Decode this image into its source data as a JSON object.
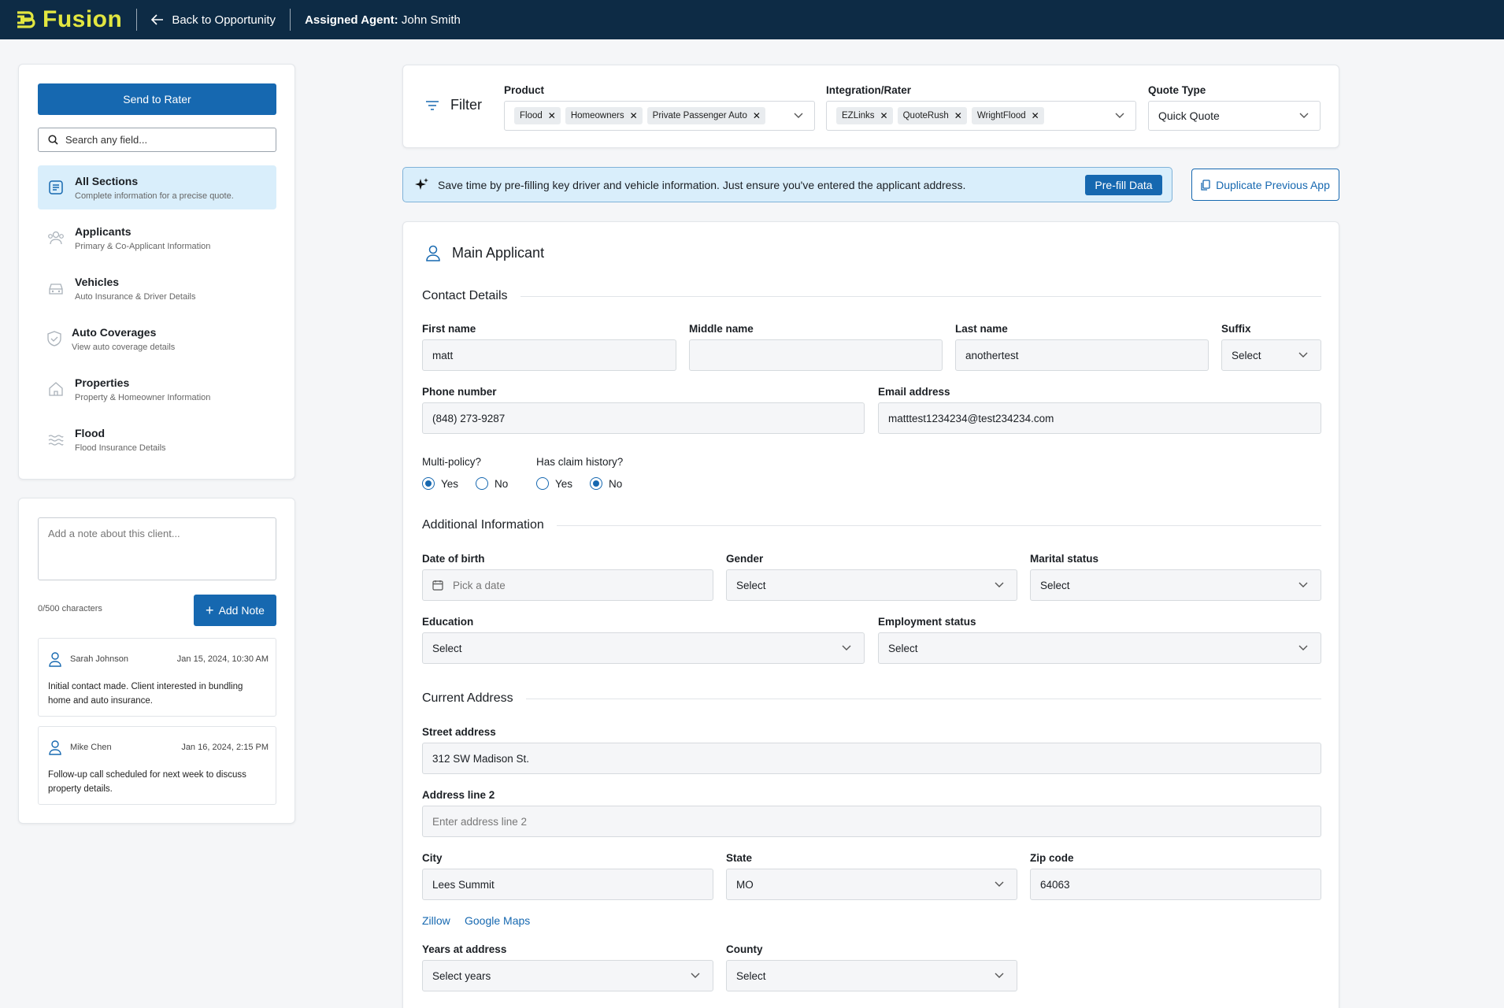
{
  "topbar": {
    "logo_text": "Fusion",
    "back_label": "Back to Opportunity",
    "agent_label": "Assigned Agent:",
    "agent_name": "John Smith"
  },
  "sidebar": {
    "send_label": "Send to Rater",
    "search_placeholder": "Search any field...",
    "items": [
      {
        "title": "All Sections",
        "subtitle": "Complete information for a precise quote.",
        "icon": "all-sections-icon",
        "active": true
      },
      {
        "title": "Applicants",
        "subtitle": "Primary & Co-Applicant Information",
        "icon": "applicants-icon"
      },
      {
        "title": "Vehicles",
        "subtitle": "Auto Insurance & Driver Details",
        "icon": "car-icon"
      },
      {
        "title": "Auto Coverages",
        "subtitle": "View auto coverage details",
        "icon": "shield-icon"
      },
      {
        "title": "Properties",
        "subtitle": "Property & Homeowner Information",
        "icon": "house-icon"
      },
      {
        "title": "Flood",
        "subtitle": "Flood Insurance Details",
        "icon": "waves-icon"
      }
    ]
  },
  "notes": {
    "placeholder": "Add a note about this client...",
    "char_count": "0/500 characters",
    "add_label": "Add Note",
    "entries": [
      {
        "author": "Sarah Johnson",
        "date": "Jan 15, 2024, 10:30 AM",
        "text": "Initial contact made. Client interested in bundling home and auto insurance."
      },
      {
        "author": "Mike Chen",
        "date": "Jan 16, 2024, 2:15 PM",
        "text": "Follow-up call scheduled for next week to discuss property details."
      }
    ]
  },
  "filter": {
    "label": "Filter",
    "product": {
      "label": "Product",
      "chips": [
        "Flood",
        "Homeowners",
        "Private Passenger Auto"
      ]
    },
    "integration": {
      "label": "Integration/Rater",
      "chips": [
        "EZLinks",
        "QuoteRush",
        "WrightFlood"
      ]
    },
    "quote_type": {
      "label": "Quote Type",
      "value": "Quick Quote"
    }
  },
  "prefill": {
    "message": "Save time by pre-filling key driver and vehicle information. Just ensure you've entered the applicant address.",
    "button": "Pre-fill Data"
  },
  "duplicate_label": "Duplicate Previous App",
  "main": {
    "title": "Main Applicant",
    "contact": {
      "heading": "Contact Details",
      "first_name": {
        "label": "First name",
        "value": "matt"
      },
      "middle_name": {
        "label": "Middle name",
        "value": ""
      },
      "last_name": {
        "label": "Last name",
        "value": "anothertest"
      },
      "suffix": {
        "label": "Suffix",
        "value": "Select"
      },
      "phone": {
        "label": "Phone number",
        "value": "(848) 273-9287"
      },
      "email": {
        "label": "Email address",
        "value": "matttest1234234@test234234.com"
      },
      "multi_policy": {
        "label": "Multi-policy?",
        "yes": "Yes",
        "no": "No",
        "selected": "Yes"
      },
      "claim_history": {
        "label": "Has claim history?",
        "yes": "Yes",
        "no": "No",
        "selected": "No"
      }
    },
    "additional": {
      "heading": "Additional Information",
      "dob": {
        "label": "Date of birth",
        "placeholder": "Pick a date"
      },
      "gender": {
        "label": "Gender",
        "value": "Select"
      },
      "marital": {
        "label": "Marital status",
        "value": "Select"
      },
      "education": {
        "label": "Education",
        "value": "Select"
      },
      "employment": {
        "label": "Employment status",
        "value": "Select"
      }
    },
    "address": {
      "heading": "Current Address",
      "street": {
        "label": "Street address",
        "value": "312 SW Madison St."
      },
      "line2": {
        "label": "Address line 2",
        "placeholder": "Enter address line 2"
      },
      "city": {
        "label": "City",
        "value": "Lees Summit"
      },
      "state": {
        "label": "State",
        "value": "MO"
      },
      "zip": {
        "label": "Zip code",
        "value": "64063"
      },
      "zillow": "Zillow",
      "google_maps": "Google Maps",
      "years": {
        "label": "Years at address",
        "value": "Select years"
      },
      "county": {
        "label": "County",
        "value": "Select"
      }
    }
  },
  "colors": {
    "topbar": "#0d2b45",
    "logo": "#e2e640",
    "accent": "#1668b0",
    "active_bg": "#d9eefb"
  }
}
